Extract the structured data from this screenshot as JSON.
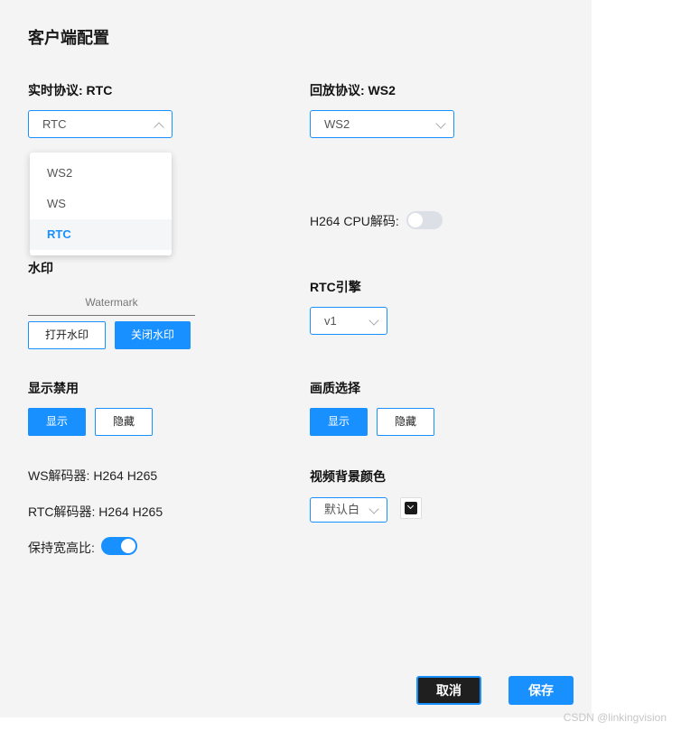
{
  "page_title": "客户端配置",
  "realtime": {
    "label": "实时协议: RTC",
    "selected": "RTC"
  },
  "playback": {
    "label": "回放协议: WS2",
    "selected": "WS2"
  },
  "dropdown_options": [
    {
      "label": "WS2"
    },
    {
      "label": "WS"
    },
    {
      "label": "RTC"
    }
  ],
  "h264_cpu": {
    "label": "H264 CPU解码:",
    "enabled": false
  },
  "watermark": {
    "label": "水印",
    "text": "Watermark",
    "open_label": "打开水印",
    "close_label": "关闭水印"
  },
  "rtc_engine": {
    "label": "RTC引擎",
    "selected": "v1"
  },
  "display_disable": {
    "label": "显示禁用",
    "show_label": "显示",
    "hide_label": "隐藏"
  },
  "quality": {
    "label": "画质选择",
    "show_label": "显示",
    "hide_label": "隐藏"
  },
  "ws_decoder": {
    "text": "WS解码器:  H264 H265"
  },
  "rtc_decoder": {
    "text": "RTC解码器:  H264 H265"
  },
  "keep_ratio": {
    "label": "保持宽高比:",
    "enabled": true
  },
  "video_bg": {
    "label": "视频背景颜色",
    "selected": "默认白",
    "swatch_color": "#1a1a1a"
  },
  "footer": {
    "cancel_label": "取消",
    "save_label": "保存"
  },
  "watermark_footer": "CSDN @linkingvision",
  "colors": {
    "accent": "#1890ff",
    "panel_bg": "#f4f4f4"
  }
}
